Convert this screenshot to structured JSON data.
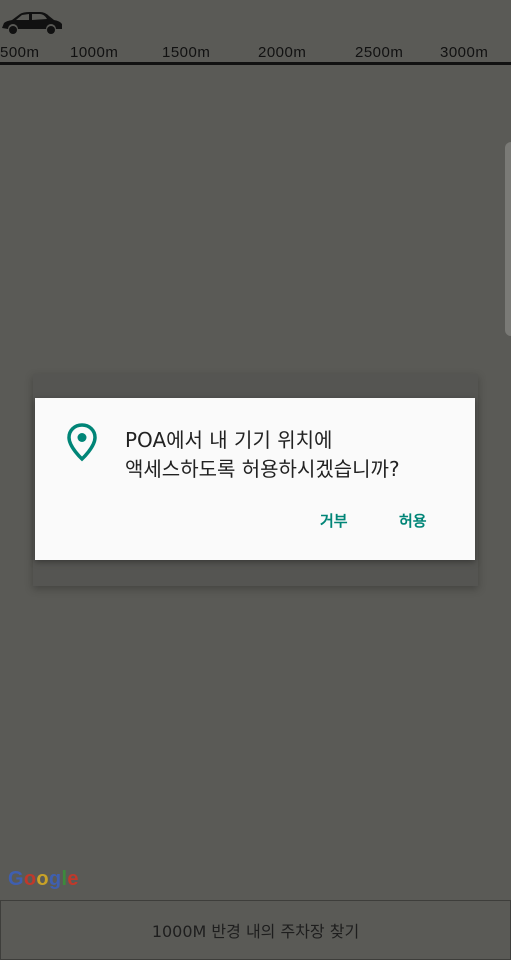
{
  "topbar": {
    "car_icon": "car-icon",
    "scale_labels": [
      "500m",
      "1000m",
      "1500m",
      "2000m",
      "2500m",
      "3000m"
    ]
  },
  "dialog": {
    "icon": "location-pin-icon",
    "message_line1": "POA에서 내 기기 위치에",
    "message_line2": "액세스하도록 허용하시겠습니까?",
    "deny_label": "거부",
    "allow_label": "허용",
    "accent_color": "#008577"
  },
  "map": {
    "attribution": "Google"
  },
  "bottom_bar": {
    "label": "1000M 반경 내의 주차장 찾기"
  }
}
